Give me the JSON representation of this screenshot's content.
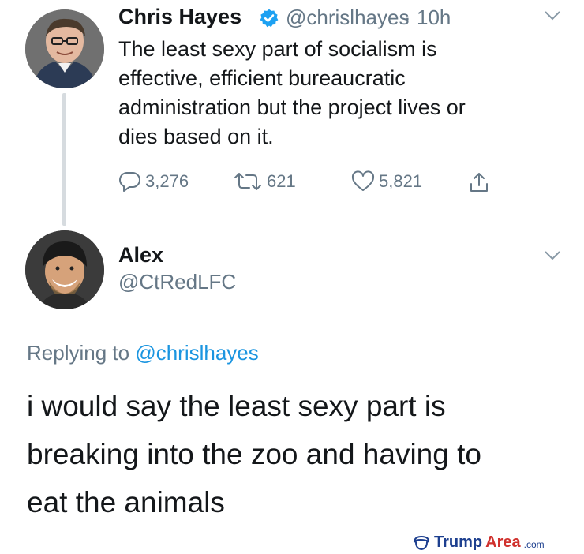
{
  "tweet": {
    "author_name": "Chris Hayes",
    "author_handle": "@chrislhayes",
    "separator": "·",
    "time": "10h",
    "text_lines": [
      "The least sexy part of socialism is",
      "effective, efficient bureaucratic",
      "administration but the project lives or",
      "dies based on it."
    ],
    "replies": "3,276",
    "retweets": "621",
    "likes": "5,821"
  },
  "reply": {
    "author_name": "Alex",
    "author_handle": "@CtRedLFC",
    "replying_prefix": "Replying to",
    "replying_to": "@chrislhayes",
    "text_lines": [
      "i would say the least sexy part is",
      "breaking into the zoo and having to",
      "eat the animals"
    ]
  },
  "watermark": {
    "part1": "Trump",
    "part2": "Area",
    "part3": ".com"
  },
  "colors": {
    "text": "#14171a",
    "secondary": "#657786",
    "link": "#1b95e0",
    "verified": "#1da1f2"
  }
}
